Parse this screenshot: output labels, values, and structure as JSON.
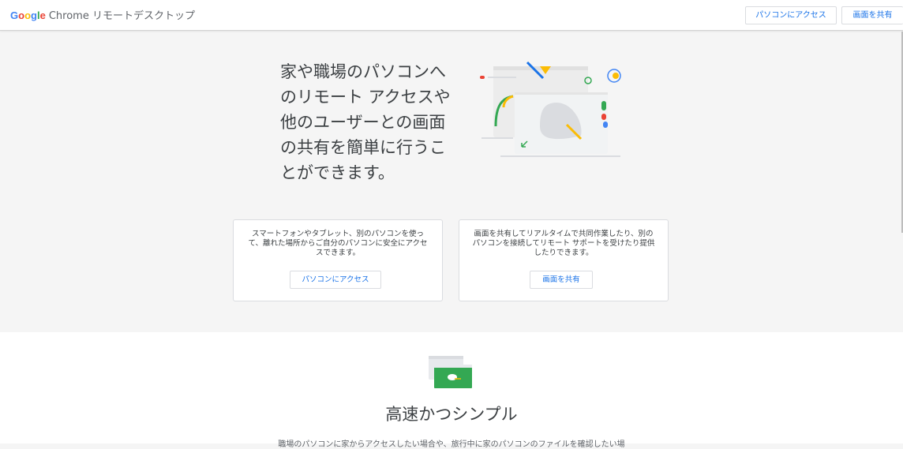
{
  "header": {
    "brand": {
      "letters": [
        "G",
        "o",
        "o",
        "g",
        "l",
        "e"
      ],
      "product": "Chrome リモートデスクトップ"
    },
    "access_button": "パソコンにアクセス",
    "share_button": "画面を共有"
  },
  "hero": {
    "title_lines": [
      "家や職場のパソコンへ",
      "のリモート アクセスや",
      "他のユーザーとの画面",
      "の共有を簡単に行うこ",
      "とができます。"
    ]
  },
  "cards": [
    {
      "description": "スマートフォンやタブレット、別のパソコンを使って、離れた場所からご自分のパソコンに安全にアクセスできます。",
      "button": "パソコンにアクセス"
    },
    {
      "description": "画面を共有してリアルタイムで共同作業したり、別のパソコンを接続してリモート サポートを受けたり提供したりできます。",
      "button": "画面を共有"
    }
  ],
  "section2": {
    "title": "高速かつシンプル",
    "description": "職場のパソコンに家からアクセスしたい場合や、旅行中に家のパソコンのファイルを確認したい場"
  },
  "colors": {
    "google_blue": "#4285f4",
    "google_red": "#ea4335",
    "google_yellow": "#fbbc05",
    "google_green": "#34a853",
    "link_blue": "#1a73e8"
  }
}
